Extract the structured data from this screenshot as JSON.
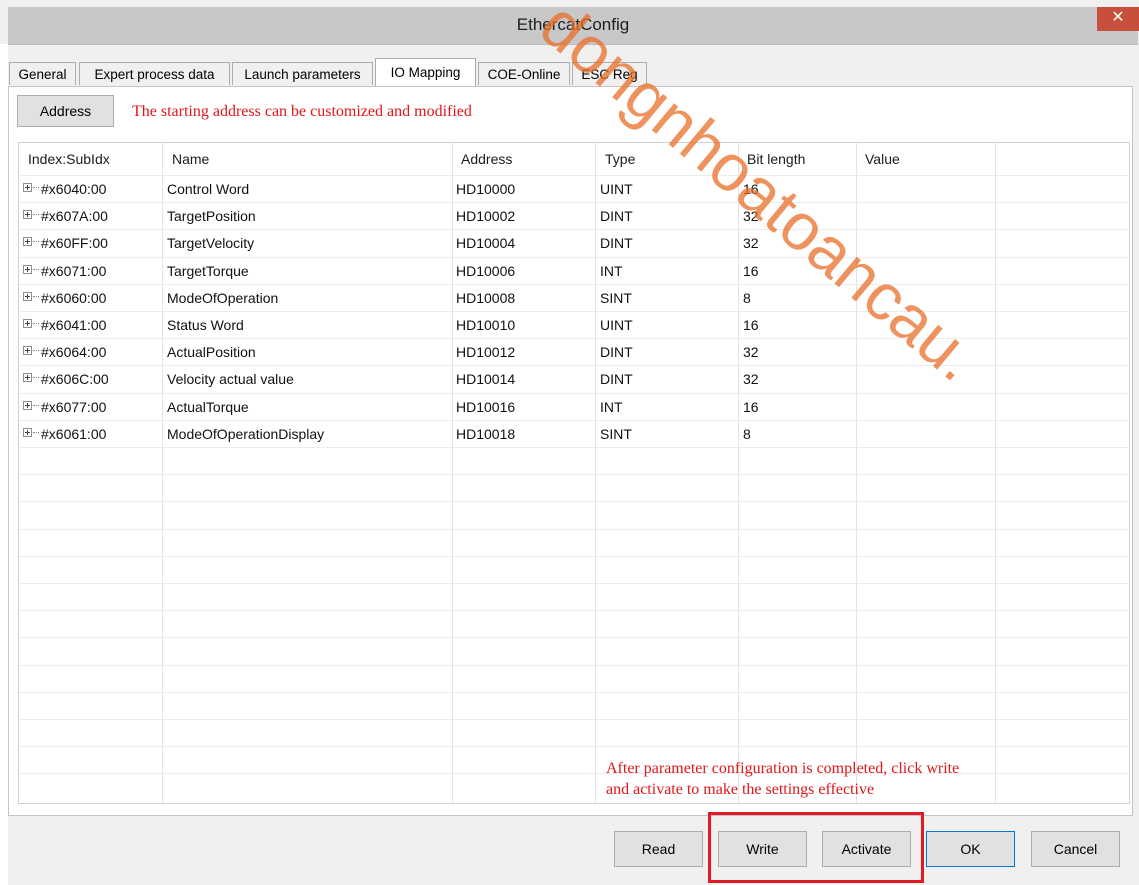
{
  "window": {
    "title": "EthercatConfig",
    "close_glyph": "✕"
  },
  "tabs": [
    {
      "label": "General",
      "active": false
    },
    {
      "label": "Expert process data",
      "active": false
    },
    {
      "label": "Launch parameters",
      "active": false
    },
    {
      "label": "IO Mapping",
      "active": true
    },
    {
      "label": "COE-Online",
      "active": false
    },
    {
      "label": "ESC Reg",
      "active": false
    }
  ],
  "toolbar": {
    "address_button": "Address"
  },
  "annotations": {
    "address_note": "The starting address can be customized and modified",
    "bottom_note_line1": "After parameter configuration is completed, click write",
    "bottom_note_line2": "and activate to make the settings effective"
  },
  "table": {
    "columns": [
      "Index:SubIdx",
      "Name",
      "Address",
      "Type",
      "Bit length",
      "Value"
    ],
    "rows": [
      {
        "index": "#x6040:00",
        "name": "Control Word",
        "address": "HD10000",
        "type": "UINT",
        "bits": "16",
        "value": ""
      },
      {
        "index": "#x607A:00",
        "name": "TargetPosition",
        "address": "HD10002",
        "type": "DINT",
        "bits": "32",
        "value": ""
      },
      {
        "index": "#x60FF:00",
        "name": "TargetVelocity",
        "address": "HD10004",
        "type": "DINT",
        "bits": "32",
        "value": ""
      },
      {
        "index": "#x6071:00",
        "name": "TargetTorque",
        "address": "HD10006",
        "type": "INT",
        "bits": "16",
        "value": ""
      },
      {
        "index": "#x6060:00",
        "name": "ModeOfOperation",
        "address": "HD10008",
        "type": "SINT",
        "bits": "8",
        "value": ""
      },
      {
        "index": "#x6041:00",
        "name": "Status Word",
        "address": "HD10010",
        "type": "UINT",
        "bits": "16",
        "value": ""
      },
      {
        "index": "#x6064:00",
        "name": "ActualPosition",
        "address": "HD10012",
        "type": "DINT",
        "bits": "32",
        "value": ""
      },
      {
        "index": "#x606C:00",
        "name": "Velocity actual value",
        "address": "HD10014",
        "type": "DINT",
        "bits": "32",
        "value": ""
      },
      {
        "index": "#x6077:00",
        "name": "ActualTorque",
        "address": "HD10016",
        "type": "INT",
        "bits": "16",
        "value": ""
      },
      {
        "index": "#x6061:00",
        "name": "ModeOfOperationDisplay",
        "address": "HD10018",
        "type": "SINT",
        "bits": "8",
        "value": ""
      }
    ]
  },
  "buttons": {
    "read": "Read",
    "write": "Write",
    "activate": "Activate",
    "ok": "OK",
    "cancel": "Cancel"
  },
  "watermark": {
    "text": "dongnhoatoancau."
  },
  "colors": {
    "annotation_red": "#e0161a",
    "highlight_box": "#e01b24",
    "watermark_orange": "#e86e28"
  }
}
